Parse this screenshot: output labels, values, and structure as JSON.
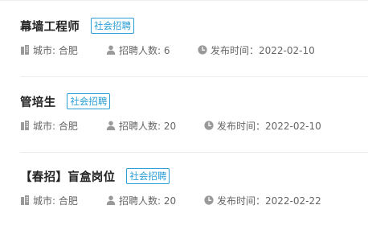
{
  "jobs": [
    {
      "title": "幕墙工程师",
      "tag": "社会招聘",
      "city": "城市: 合肥",
      "headcount": "招聘人数: 6",
      "date": "发布时间：2022-02-10"
    },
    {
      "title": "管培生",
      "tag": "社会招聘",
      "city": "城市: 合肥",
      "headcount": "招聘人数: 20",
      "date": "发布时间：2022-02-10"
    },
    {
      "title": "【春招】盲盒岗位",
      "tag": "社会招聘",
      "city": "城市: 合肥",
      "headcount": "招聘人数: 20",
      "date": "发布时间：2022-02-22"
    }
  ],
  "icons": {
    "city": "building-icon",
    "headcount": "person-icon",
    "date": "clock-icon"
  },
  "colors": {
    "tag": "#2b9fd6",
    "icon": "#9a9a9a",
    "divider": "#ececec"
  }
}
